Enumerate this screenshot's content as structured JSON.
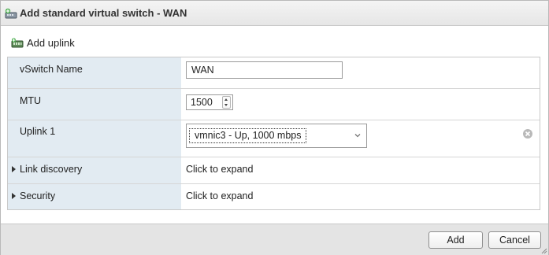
{
  "dialog": {
    "title": "Add standard virtual switch - WAN",
    "icon": "virtual-switch-add-icon"
  },
  "toolbar": {
    "add_uplink_label": "Add uplink",
    "add_uplink_icon": "add-uplink-icon"
  },
  "form": {
    "vswitch_name": {
      "label": "vSwitch Name",
      "value": "WAN"
    },
    "mtu": {
      "label": "MTU",
      "value": "1500"
    },
    "uplink1": {
      "label": "Uplink 1",
      "selected": "vmnic3 - Up, 1000 mbps"
    },
    "link_discovery": {
      "label": "Link discovery",
      "value": "Click to expand"
    },
    "security": {
      "label": "Security",
      "value": "Click to expand"
    }
  },
  "footer": {
    "add_label": "Add",
    "cancel_label": "Cancel"
  },
  "colors": {
    "label_column_bg": "#e2ebf2",
    "titlebar_bg": "#eeeeee",
    "footer_bg": "#e4e4e4",
    "accent_green": "#4caf50"
  }
}
